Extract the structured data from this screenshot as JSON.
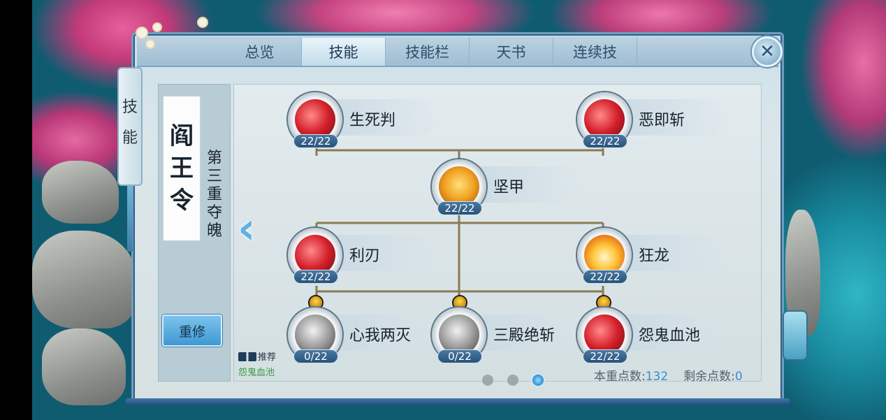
{
  "tabs": [
    {
      "label": "总览",
      "active": false
    },
    {
      "label": "技能",
      "active": true
    },
    {
      "label": "技能栏",
      "active": false
    },
    {
      "label": "天书",
      "active": false
    },
    {
      "label": "连续技",
      "active": false
    }
  ],
  "close_icon": "close-icon",
  "side_tag": [
    "技",
    "能"
  ],
  "school": {
    "name_chars": [
      "阎",
      "王",
      "令"
    ],
    "subtitle_chars": [
      "第",
      "三",
      "重",
      "夺",
      "魄"
    ]
  },
  "reset_button": "重修",
  "recommend": {
    "label": "推荐",
    "skill": "怨鬼血池"
  },
  "skills": [
    {
      "name": "生死判",
      "level": "22/22",
      "icon": "red-swirl-icon",
      "locked": false
    },
    {
      "name": "恶即斩",
      "level": "22/22",
      "icon": "red-slash-icon",
      "locked": false
    },
    {
      "name": "坚甲",
      "level": "22/22",
      "icon": "golden-shield-icon",
      "locked": false
    },
    {
      "name": "利刃",
      "level": "22/22",
      "icon": "blade-icon",
      "locked": false
    },
    {
      "name": "狂龙",
      "level": "22/22",
      "icon": "burst-icon",
      "locked": false
    },
    {
      "name": "心我两灭",
      "level": "0/22",
      "icon": "grey-swirl-icon",
      "locked": true
    },
    {
      "name": "三殿绝斩",
      "level": "0/22",
      "icon": "grey-slash-icon",
      "locked": true
    },
    {
      "name": "怨鬼血池",
      "level": "22/22",
      "icon": "blood-pool-icon",
      "locked": true
    }
  ],
  "points": {
    "tier_label": "本重点数:",
    "tier_value": "132",
    "remaining_label": "剩余点数:",
    "remaining_value": "0"
  },
  "pager": {
    "count": 3,
    "active_index": 2
  }
}
